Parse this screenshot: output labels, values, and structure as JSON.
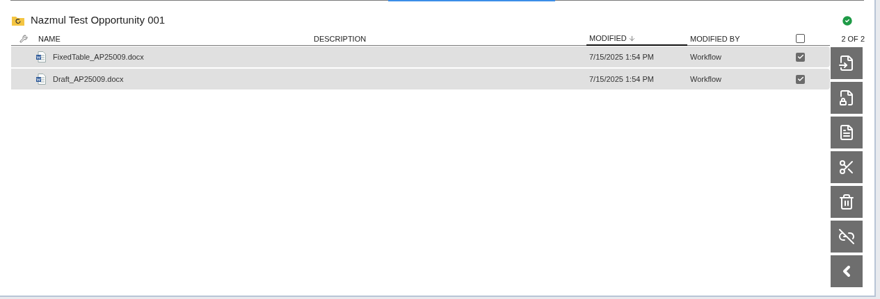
{
  "folder": {
    "title": "Nazmul Test Opportunity 001",
    "synced": true
  },
  "columns": [
    {
      "label": "NAME",
      "sorted": false
    },
    {
      "label": "DESCRIPTION",
      "sorted": false
    },
    {
      "label": "MODIFIED",
      "sorted": true
    },
    {
      "label": "MODIFIED BY",
      "sorted": false
    }
  ],
  "select_all": {
    "checked": false
  },
  "count": "2 OF 2",
  "rows": [
    {
      "name": "FixedTable_AP25009.docx",
      "description": "",
      "modified": "7/15/2025 1:54 PM",
      "modified_by": "Workflow",
      "checked": true
    },
    {
      "name": "Draft_AP25009.docx",
      "modified": "7/15/2025 1:54 PM",
      "modified_by": "Workflow",
      "checked": true
    }
  ],
  "actions": [
    {
      "kind": "checkin"
    },
    {
      "kind": "checkout"
    },
    {
      "kind": "copy"
    },
    {
      "kind": "cut"
    },
    {
      "kind": "delete"
    },
    {
      "kind": "unlink"
    },
    {
      "kind": "collapse"
    }
  ]
}
